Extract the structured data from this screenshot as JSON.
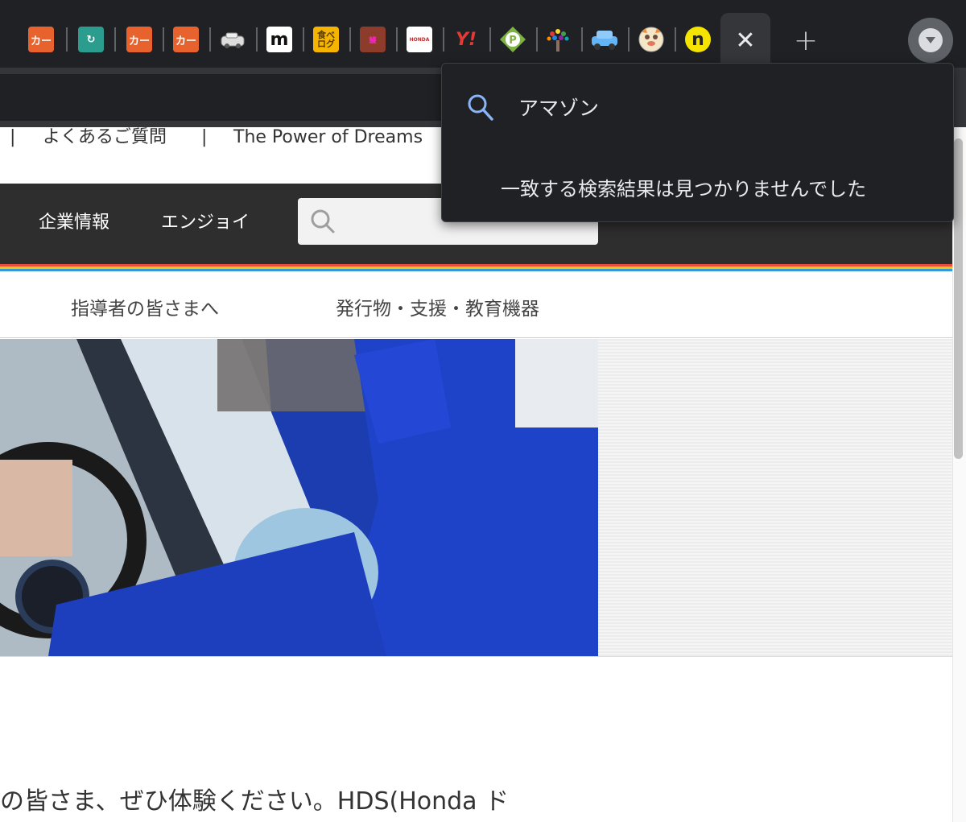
{
  "tabstrip": {
    "tabs": [
      {
        "icon": "kar-orange-icon",
        "glyph": "カー"
      },
      {
        "icon": "teal-arrow-icon",
        "glyph": "↻"
      },
      {
        "icon": "kar-orange-icon",
        "glyph": "カー"
      },
      {
        "icon": "kar-orange-icon",
        "glyph": "カー"
      },
      {
        "icon": "car-sketch-icon",
        "glyph": ""
      },
      {
        "icon": "m-letter-icon",
        "glyph": "m"
      },
      {
        "icon": "tabelog-icon",
        "glyph": "食べログ"
      },
      {
        "icon": "calligraphy-icon",
        "glyph": "鰻"
      },
      {
        "icon": "honda-icon",
        "glyph": "HONDA"
      },
      {
        "icon": "yahoo-icon",
        "glyph": "Y!"
      },
      {
        "icon": "parking-diamond-icon",
        "glyph": "P"
      },
      {
        "icon": "tree-icon",
        "glyph": ""
      },
      {
        "icon": "blue-car-icon",
        "glyph": ""
      },
      {
        "icon": "animal-face-icon",
        "glyph": ""
      },
      {
        "icon": "n-yellow-icon",
        "glyph": "n"
      }
    ],
    "active_tab_close": "✕",
    "new_tab": "+",
    "tab_search_icon": "chevron-down-icon"
  },
  "site": {
    "topnav": [
      "|",
      "よくあるご質問",
      "|",
      "The Power of Dreams"
    ],
    "main_nav": [
      "企業情報",
      "エンジョイ"
    ],
    "search_icon": "search-icon",
    "sub_nav": [
      "指導者の皆さまへ",
      "発行物・支援・教育機器"
    ],
    "stripe_colors": [
      "#e74c3c",
      "#f1c40f",
      "#3498db"
    ],
    "body_text": "の皆さま、ぜひ体験ください。HDS(Honda ド"
  },
  "dropdown": {
    "query": "アマゾン",
    "message": "一致する検索結果は見つかりませんでした"
  }
}
